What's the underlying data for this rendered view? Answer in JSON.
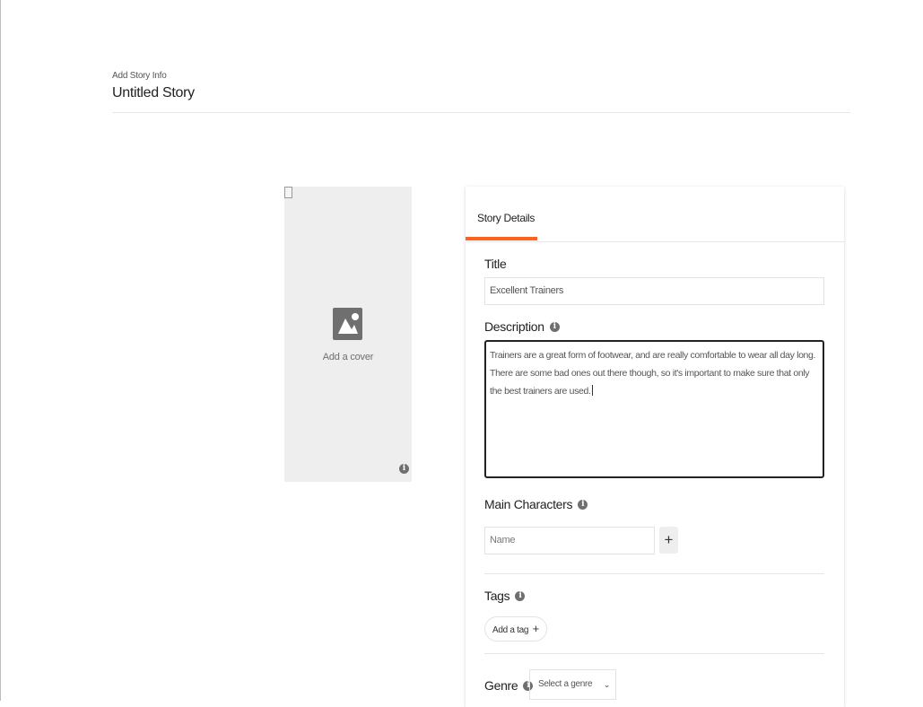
{
  "header": {
    "crumb": "Add Story Info",
    "title": "Untitled Story"
  },
  "cover": {
    "label": "Add a cover",
    "icon": "image-icon"
  },
  "details": {
    "tab_label": "Story Details",
    "title_label": "Title",
    "title_value": "Excellent Trainers",
    "description_label": "Description",
    "description_value": "Trainers are a great form of footwear, and are really comfortable to wear all day long. There are some bad ones out there though, so it's important to make sure that only the best trainers are used.",
    "characters_label": "Main Characters",
    "character_placeholder": "Name",
    "add_character_label": "+",
    "tags_label": "Tags",
    "add_tag_label": "Add a tag",
    "add_tag_plus": "+",
    "genre_label": "Genre",
    "genre_value": "Select a genre",
    "info_glyph": "i"
  },
  "colors": {
    "accent": "#ff6122",
    "icon_gray": "#6f6f6f",
    "cover_bg": "#eeeeee"
  }
}
